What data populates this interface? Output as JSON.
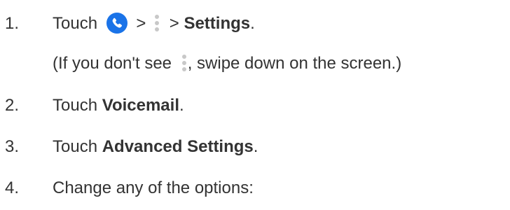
{
  "steps": [
    {
      "number": "1.",
      "prefix": "Touch",
      "separator1": ">",
      "separator2": ">",
      "bold": "Settings",
      "suffix": ".",
      "note_prefix": "(If you don't see",
      "note_suffix": ", swipe down on the screen.)"
    },
    {
      "number": "2.",
      "prefix": "Touch",
      "bold": "Voicemail",
      "suffix": "."
    },
    {
      "number": "3.",
      "prefix": "Touch",
      "bold": "Advanced Settings",
      "suffix": "."
    },
    {
      "number": "4.",
      "text": "Change any of the options:"
    }
  ],
  "icons": {
    "phone": "phone-app-icon",
    "menu": "more-options-icon",
    "phone_color": "#1a73e8",
    "menu_color": "#c8c8c8"
  }
}
